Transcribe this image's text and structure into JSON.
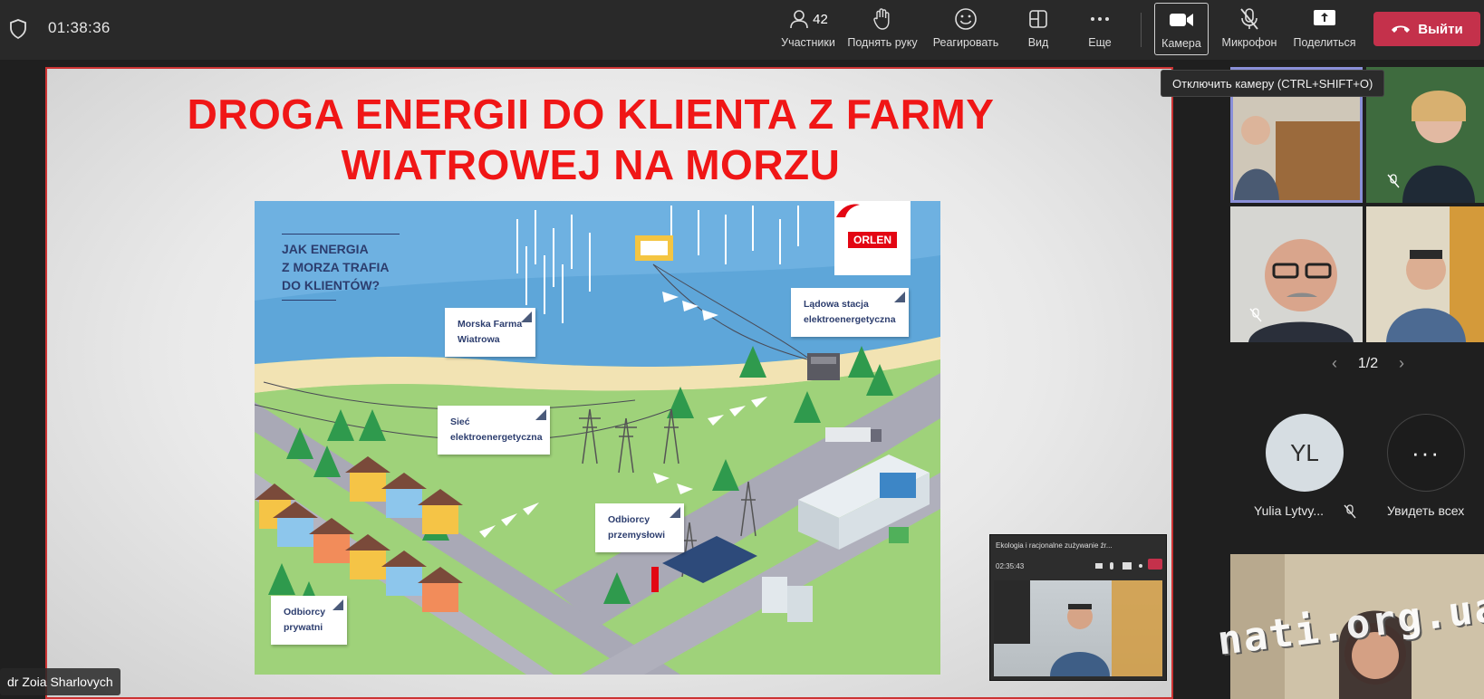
{
  "meeting": {
    "timer": "01:38:36"
  },
  "toolbar": {
    "participants": {
      "label": "Участники",
      "count": "42"
    },
    "raise_hand": {
      "label": "Поднять руку"
    },
    "react": {
      "label": "Реагировать"
    },
    "view": {
      "label": "Вид"
    },
    "more": {
      "label": "Еще"
    },
    "camera": {
      "label": "Камера"
    },
    "mic": {
      "label": "Микрофон"
    },
    "share": {
      "label": "Поделиться"
    },
    "leave": {
      "label": "Выйти"
    }
  },
  "tooltip": "Отключить камеру (CTRL+SHIFT+O)",
  "slide": {
    "title_line1": "DROGA ENERGII DO KLIENTA Z FARMY",
    "title_line2": "WIATROWEJ NA MORZU",
    "question_line1": "JAK ENERGIA",
    "question_line2": "Z MORZA TRAFIA",
    "question_line3": "DO KLIENTÓW?",
    "brand": "ORLEN",
    "cards": {
      "offshore_line1": "Morska Farma",
      "offshore_line2": "Wiatrowa",
      "onshore_line1": "Lądowa stacja",
      "onshore_line2": "elektroenergetyczna",
      "grid_line1": "Sieć",
      "grid_line2": "elektroenergetyczna",
      "industrial_line1": "Odbiorcy",
      "industrial_line2": "przemysłowi",
      "private_line1": "Odbiorcy",
      "private_line2": "prywatni"
    }
  },
  "presenter": {
    "name": "dr Zoia Sharlovych"
  },
  "mini_window": {
    "title": "Ekologia i racjonalne zużywanie źr...",
    "time": "02:35:43"
  },
  "gallery": {
    "page": "1/2",
    "avatar_initials": "YL",
    "avatar_name": "Yulia Lytvy...",
    "see_all": "Увидеть всех"
  },
  "watermark": "nati.org.ua",
  "colors": {
    "accent_red": "#c4314b",
    "slide_title": "#f01616",
    "selected_tile": "#8a8fd8"
  }
}
